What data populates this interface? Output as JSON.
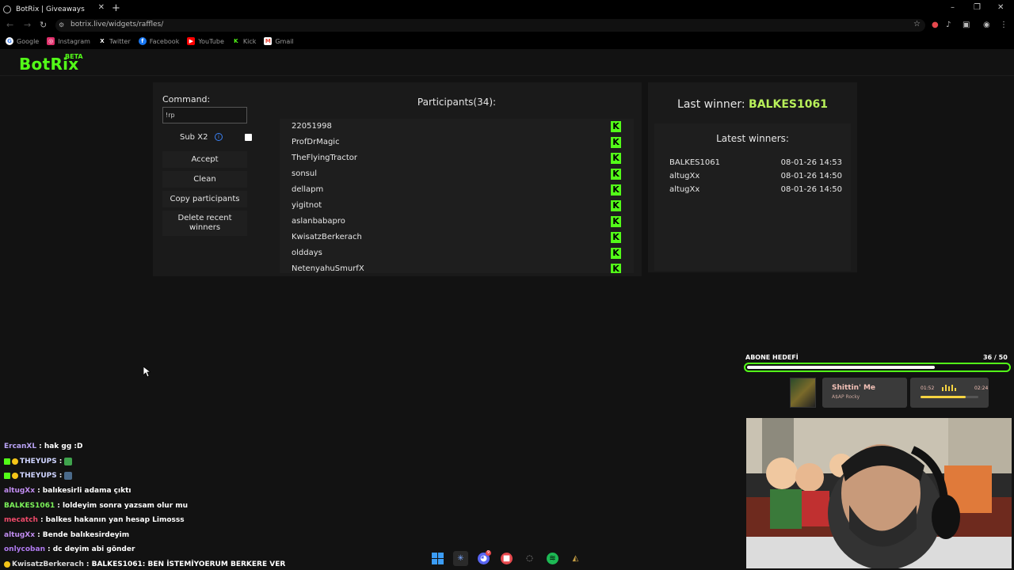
{
  "browser": {
    "tab_title": "BotRix | Giveaways",
    "tab_close": "✕",
    "new_tab": "+",
    "url": "botrix.live/widgets/raffles/",
    "window_controls": [
      "–",
      "❐",
      "✕"
    ],
    "bookmarks": [
      {
        "label": "Google",
        "icon": "google-icon",
        "color": "#ffffff"
      },
      {
        "label": "Instagram",
        "icon": "instagram-icon",
        "color": "#e1306c"
      },
      {
        "label": "Twitter",
        "icon": "x-icon",
        "color": "#000000"
      },
      {
        "label": "Facebook",
        "icon": "facebook-icon",
        "color": "#1877f2"
      },
      {
        "label": "YouTube",
        "icon": "youtube-icon",
        "color": "#ff0000"
      },
      {
        "label": "Kick",
        "icon": "kick-icon",
        "color": "#53fc18"
      },
      {
        "label": "Gmail",
        "icon": "gmail-icon",
        "color": "#ea4335"
      }
    ]
  },
  "app": {
    "logo": "BotRix",
    "logo_badge": "BETA",
    "accent": "#53fc18"
  },
  "raffle": {
    "command_label": "Command:",
    "command_value": "!rp",
    "sub_label": "Sub X2",
    "buttons": {
      "accept": "Accept",
      "clean": "Clean",
      "copy": "Copy participants",
      "delete": "Delete recent winners"
    },
    "participants_title": "Participants(34):",
    "participants": [
      "22051998",
      "ProfDrMagic",
      "TheFlyingTractor",
      "sonsul",
      "dellapm",
      "yigitnot",
      "aslanbabapro",
      "KwisatzBerkerach",
      "olddays",
      "NetenyahuSmurfX"
    ],
    "kick_badge": "K"
  },
  "winners": {
    "last_winner_label": "Last winner:",
    "last_winner_name": "BALKES1061",
    "latest_title": "Latest winners:",
    "rows": [
      {
        "name": "BALKES1061",
        "time": "08-01-26 14:53"
      },
      {
        "name": "altugXx",
        "time": "08-01-26 14:50"
      },
      {
        "name": "altugXx",
        "time": "08-01-26 14:50"
      }
    ]
  },
  "overlay": {
    "goal_label": "ABONE HEDEFİ",
    "goal_count": "36 / 50",
    "goal_progress": 0.72,
    "song_title": "Shittin' Me",
    "song_artist": "A$AP Rocky",
    "time_current": "01:52",
    "time_total": "02:24",
    "song_progress": 0.78
  },
  "chat": [
    {
      "user": "ErcanXL",
      "color": "#b9a3f5",
      "message": "hak gg :D",
      "badges": []
    },
    {
      "user": "THEYUPS",
      "color": "#cfd4ff",
      "message": "",
      "badges": [
        "#53fc18",
        "#f5c518"
      ],
      "emote": "#3fa34d"
    },
    {
      "user": "THEYUPS",
      "color": "#cfd4ff",
      "message": "",
      "badges": [
        "#53fc18",
        "#f5c518"
      ],
      "emote": "#4a6a8a"
    },
    {
      "user": "altugXx",
      "color": "#c08cf0",
      "message": "balıkesirli adama çıktı",
      "badges": []
    },
    {
      "user": "BALKES1061",
      "color": "#7cf25a",
      "message": "loldeyim sonra yazsam olur mu",
      "badges": []
    },
    {
      "user": "mecatch",
      "color": "#f04a6a",
      "message": "balkes hakanın yan hesap Limosss",
      "badges": []
    },
    {
      "user": "altugXx",
      "color": "#c08cf0",
      "message": "Bende balıkesirdeyim",
      "badges": []
    },
    {
      "user": "onlycoban",
      "color": "#b07af0",
      "message": "dc deyim abi gönder",
      "badges": []
    },
    {
      "user": "KwisatzBerkerach",
      "color": "#d8d8d8",
      "message": "BALKES1061: BEN İSTEMİYOERUM BERKERE VER",
      "badges": [
        "#f5c518"
      ]
    }
  ],
  "taskbar": [
    {
      "icon": "windows-start-icon",
      "color": "#3b9cf5",
      "active": false
    },
    {
      "icon": "snowflake-app-icon",
      "color": "#7aa8ff",
      "active": true
    },
    {
      "icon": "discord-icon",
      "color": "#5865f2",
      "active": false,
      "badge": "9+"
    },
    {
      "icon": "red-app-icon",
      "color": "#e5484d",
      "active": false
    },
    {
      "icon": "obs-icon",
      "color": "#888888",
      "active": false
    },
    {
      "icon": "spotify-icon",
      "color": "#1db954",
      "active": false
    },
    {
      "icon": "league-icon",
      "color": "#c8a045",
      "active": false
    }
  ]
}
